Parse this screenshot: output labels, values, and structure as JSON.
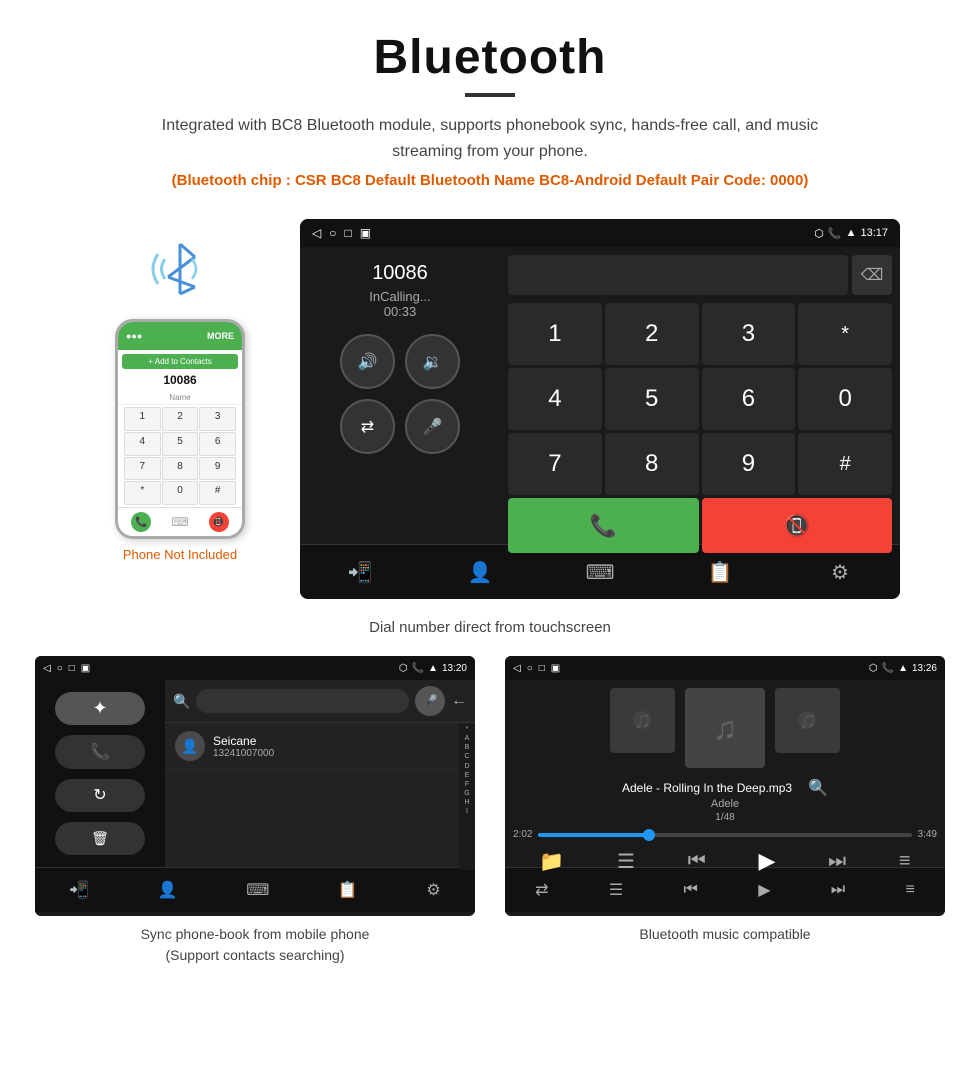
{
  "page": {
    "title": "Bluetooth",
    "description": "Integrated with BC8 Bluetooth module, supports phonebook sync, hands-free call, and music streaming from your phone.",
    "info_line": "(Bluetooth chip : CSR BC8    Default Bluetooth Name BC8-Android    Default Pair Code: 0000)"
  },
  "dialpad_screen": {
    "status_time": "13:17",
    "call_number": "10086",
    "call_status": "InCalling...",
    "call_timer": "00:33",
    "numpad": [
      "1",
      "2",
      "3",
      "*",
      "4",
      "5",
      "6",
      "0",
      "7",
      "8",
      "9",
      "#"
    ],
    "caption": "Dial number direct from touchscreen"
  },
  "phonebook_screen": {
    "status_time": "13:20",
    "contact_name": "Seicane",
    "contact_number": "13241007000",
    "alpha_letters": [
      "*",
      "A",
      "B",
      "C",
      "D",
      "E",
      "F",
      "G",
      "H",
      "I"
    ],
    "caption_line1": "Sync phone-book from mobile phone",
    "caption_line2": "(Support contacts searching)"
  },
  "music_screen": {
    "status_time": "13:26",
    "track_title": "Adele - Rolling In the Deep.mp3",
    "track_artist": "Adele",
    "track_count": "1/48",
    "time_current": "2:02",
    "time_total": "3:49",
    "caption": "Bluetooth music compatible"
  },
  "phone_mockup": {
    "not_included_text": "Phone Not Included"
  },
  "icons": {
    "back": "◁",
    "home": "○",
    "recent": "□",
    "screenshot": "▣",
    "location": "📍",
    "phone_signal": "📶",
    "wifi": "▲",
    "clock": "13:17",
    "speaker": "🔊",
    "vol_down": "🔉",
    "transfer": "⇄",
    "mic": "🎤",
    "keypad": "⌨",
    "contacts": "👤",
    "settings": "⚙",
    "bluetooth": "✦",
    "call": "📞",
    "sync": "↻",
    "delete": "🗑",
    "search": "🔍",
    "shuffle": "⇄",
    "prev": "⏮",
    "play": "▶",
    "next": "⏭",
    "eq": "≡",
    "folder": "📁",
    "list": "☰",
    "music_note": "♫"
  }
}
